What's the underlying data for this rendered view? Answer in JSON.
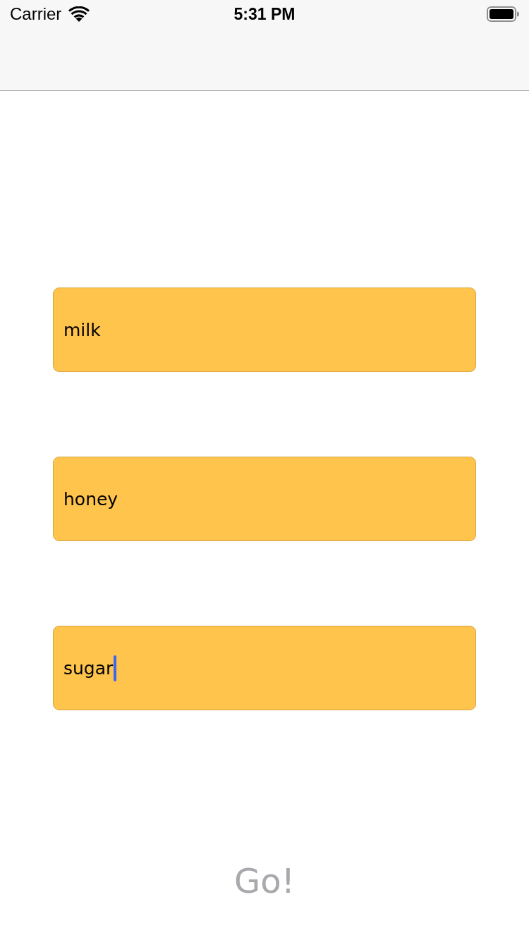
{
  "status_bar": {
    "carrier": "Carrier",
    "time": "5:31 PM"
  },
  "fields": [
    {
      "value": "milk",
      "focused": false
    },
    {
      "value": "honey",
      "focused": false
    },
    {
      "value": "sugar",
      "focused": true
    }
  ],
  "go_button": {
    "label": "Go!",
    "disabled": true
  }
}
